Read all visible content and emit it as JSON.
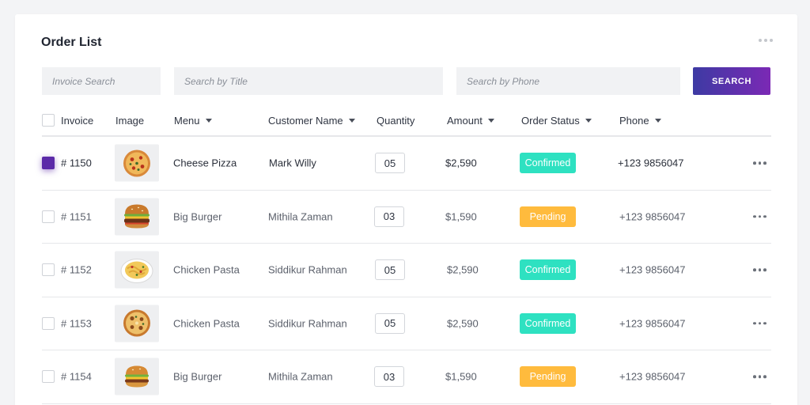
{
  "card": {
    "title": "Order List"
  },
  "filters": {
    "invoice_placeholder": "Invoice Search",
    "title_placeholder": "Search by Title",
    "phone_placeholder": "Search by Phone",
    "search_label": "SEARCH"
  },
  "columns": {
    "invoice": "Invoice",
    "image": "Image",
    "menu": "Menu",
    "customer": "Customer Name",
    "quantity": "Quantity",
    "amount": "Amount",
    "status": "Order Status",
    "phone": "Phone"
  },
  "rows": [
    {
      "invoice": "# 1150",
      "image": "pizza-icon",
      "menu": "Cheese Pizza",
      "customer": "Mark Willy",
      "quantity": "05",
      "amount": "$2,590",
      "status": "Confirmed",
      "phone": "+123 9856047",
      "checked": true
    },
    {
      "invoice": "# 1151",
      "image": "burger-icon",
      "menu": "Big Burger",
      "customer": "Mithila Zaman",
      "quantity": "03",
      "amount": "$1,590",
      "status": "Pending",
      "phone": "+123 9856047",
      "checked": false
    },
    {
      "invoice": "# 1152",
      "image": "pasta-icon",
      "menu": "Chicken Pasta",
      "customer": "Siddikur Rahman",
      "quantity": "05",
      "amount": "$2,590",
      "status": "Confirmed",
      "phone": "+123 9856047",
      "checked": false
    },
    {
      "invoice": "# 1153",
      "image": "pizza-icon",
      "menu": "Chicken Pasta",
      "customer": "Siddikur Rahman",
      "quantity": "05",
      "amount": "$2,590",
      "status": "Confirmed",
      "phone": "+123 9856047",
      "checked": false
    },
    {
      "invoice": "# 1154",
      "image": "burger-icon",
      "menu": "Big Burger",
      "customer": "Mithila Zaman",
      "quantity": "03",
      "amount": "$1,590",
      "status": "Pending",
      "phone": "+123 9856047",
      "checked": false
    }
  ],
  "colors": {
    "confirmed": "#2ee1c1",
    "pending": "#ffbb3d",
    "accent": "#5b2aa8"
  }
}
